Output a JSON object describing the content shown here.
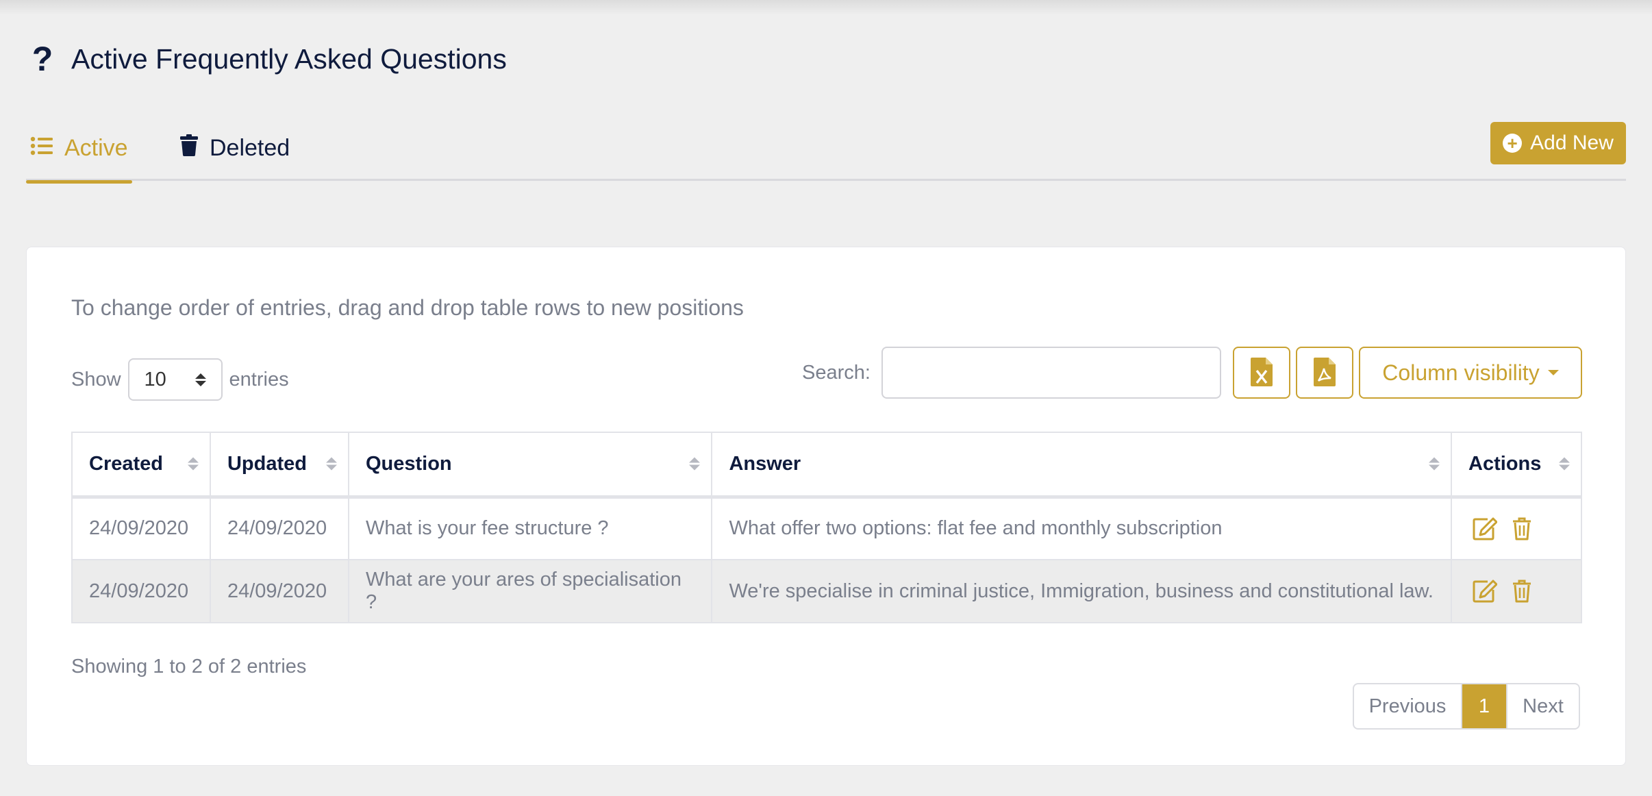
{
  "header": {
    "title": "Active Frequently Asked Questions",
    "icon": "question-icon"
  },
  "tabs": [
    {
      "label": "Active",
      "icon": "list-icon",
      "active": true
    },
    {
      "label": "Deleted",
      "icon": "trash-icon",
      "active": false
    }
  ],
  "toolbar": {
    "add_label": "Add New",
    "add_icon": "plus-circle-icon"
  },
  "colors": {
    "accent": "#c9a231",
    "text_dark": "#0f1b3d",
    "text_muted": "#7a7f8c",
    "background": "#efefef"
  },
  "card": {
    "hint": "To change order of entries, drag and drop table rows to new positions",
    "length": {
      "show_label": "Show",
      "value": "10",
      "entries_label": "entries"
    },
    "search": {
      "label": "Search:",
      "value": "",
      "placeholder": ""
    },
    "export": {
      "excel_icon": "file-excel-icon",
      "pdf_icon": "file-pdf-icon",
      "column_visibility_label": "Column visibility"
    }
  },
  "table": {
    "columns": [
      "Created",
      "Updated",
      "Question",
      "Answer",
      "Actions"
    ],
    "rows": [
      {
        "created": "24/09/2020",
        "updated": "24/09/2020",
        "question": "What is your fee structure ?",
        "answer": "What offer two options: flat fee and monthly subscription"
      },
      {
        "created": "24/09/2020",
        "updated": "24/09/2020",
        "question": "What are your ares of specialisation ?",
        "answer": "We're specialise in criminal justice, Immigration, business and constitutional law."
      }
    ],
    "action_icons": [
      "edit-icon",
      "trash-icon"
    ]
  },
  "footer": {
    "info": "Showing 1 to 2 of 2 entries",
    "pagination": {
      "previous": "Previous",
      "current": "1",
      "next": "Next"
    }
  }
}
